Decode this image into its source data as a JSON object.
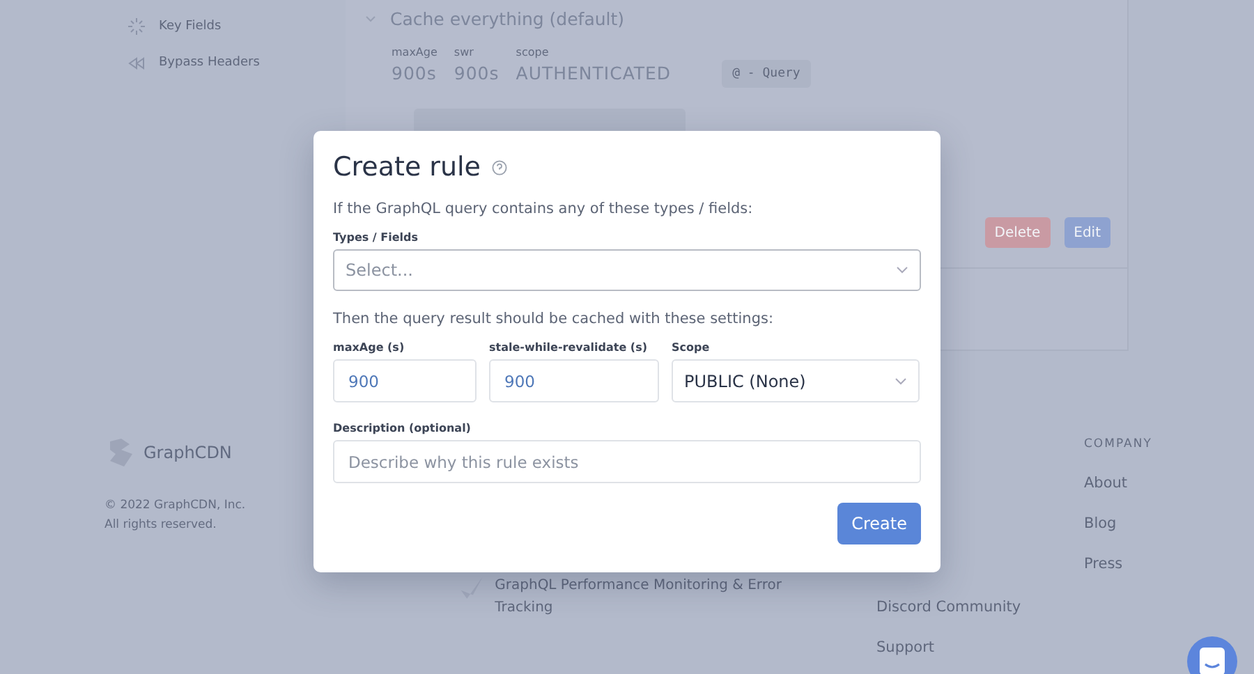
{
  "sidebar": {
    "items": [
      {
        "label": "Key Fields"
      },
      {
        "label": "Bypass Headers"
      }
    ]
  },
  "rule_card": {
    "title": "Cache everything (default)",
    "expanded": true,
    "stats": [
      {
        "label": "maxAge",
        "value": "900s"
      },
      {
        "label": "swr",
        "value": "900s"
      },
      {
        "label": "scope",
        "value": "AUTHENTICATED"
      }
    ],
    "tag": "@ - Query",
    "buttons": [
      {
        "label": "Delete",
        "kind": "danger"
      },
      {
        "label": "Edit",
        "kind": "primary"
      }
    ]
  },
  "footer": {
    "brand": "GraphCDN",
    "copyright": [
      "© 2022 GraphCDN, Inc.",
      "All rights reserved."
    ],
    "product_link": "GraphQL Performance Monitoring & Error Tracking",
    "resources": [
      "Discord Community",
      "Support"
    ],
    "company": {
      "heading": "COMPANY",
      "links": [
        "About",
        "Blog",
        "Press"
      ]
    }
  },
  "dialog": {
    "title": "Create rule",
    "intro": "If the GraphQL query contains any of these types / fields:",
    "types_label": "Types / Fields",
    "types_placeholder": "Select...",
    "settings_text": "Then the query result should be cached with these settings:",
    "max_age": {
      "label": "maxAge (s)",
      "value": "900"
    },
    "swr": {
      "label": "stale-while-revalidate (s)",
      "value": "900"
    },
    "scope": {
      "label": "Scope",
      "value": "PUBLIC (None)"
    },
    "description": {
      "label": "Description (optional)",
      "placeholder": "Describe why this rule exists"
    },
    "submit": "Create"
  }
}
